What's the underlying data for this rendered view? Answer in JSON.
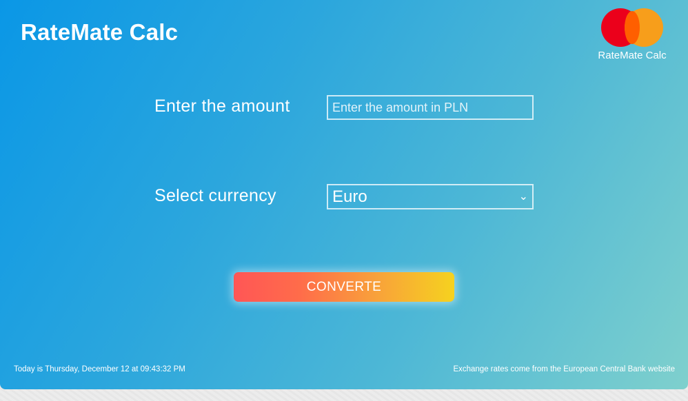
{
  "header": {
    "app_title": "RateMate Calc"
  },
  "logo": {
    "caption": "RateMate Calc",
    "icon": "two-overlapping-circles-logo",
    "colors": {
      "left_circle": "#eb001b",
      "right_circle": "#f79e1b",
      "overlap": "#ff5f00"
    }
  },
  "form": {
    "amount_label": "Enter the amount",
    "amount_placeholder": "Enter the amount in PLN",
    "amount_value": "",
    "currency_label": "Select currency",
    "currency_selected": "Euro",
    "currency_chevron_icon": "chevron-down-icon",
    "convert_label": "CONVERTE"
  },
  "footer": {
    "date_text": "Today is Thursday, December 12 at 09:43:32 PM",
    "source_text": "Exchange rates come from the European Central Bank website"
  },
  "colors": {
    "background_start": "#0a97e6",
    "background_end": "#7fd0cd",
    "button_start": "#ff5656",
    "button_end": "#f6d21f"
  }
}
